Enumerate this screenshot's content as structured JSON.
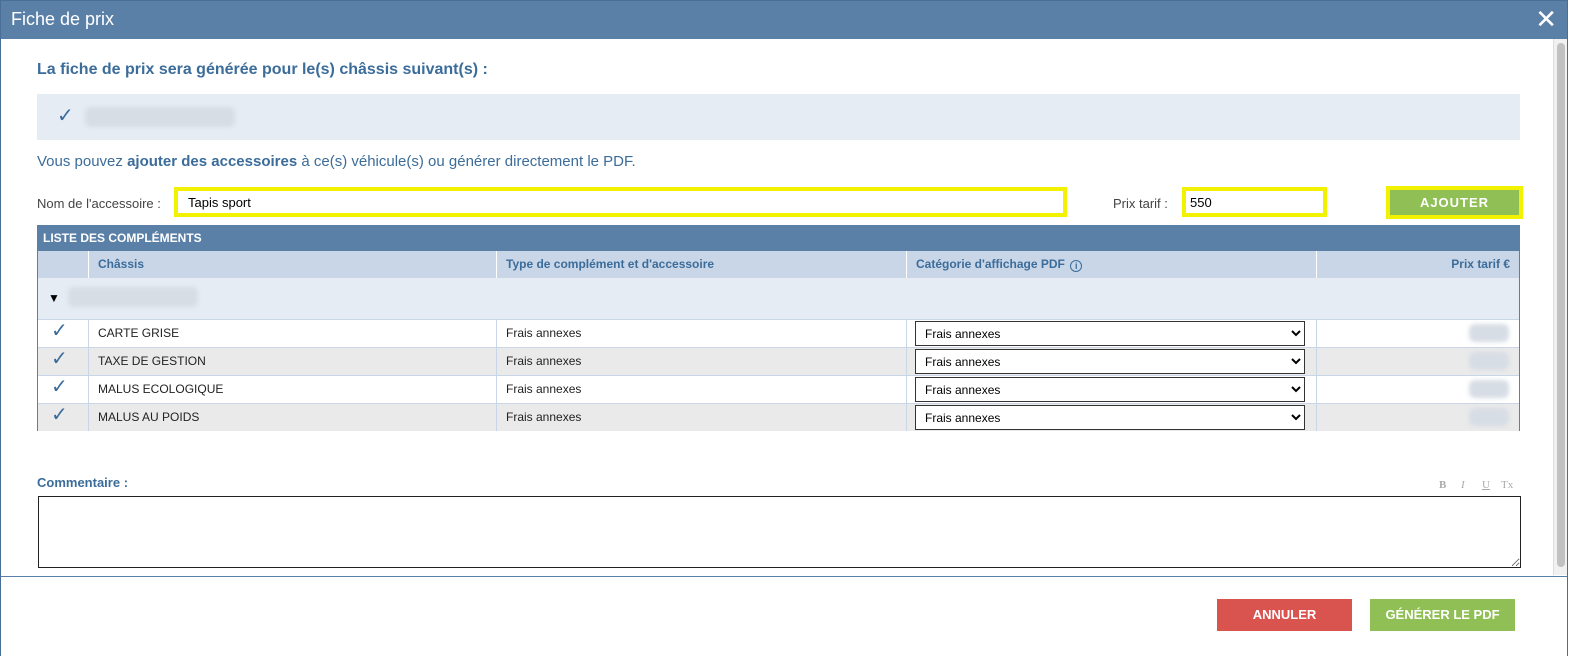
{
  "window": {
    "title": "Fiche de prix",
    "close_glyph": "✕"
  },
  "intro": {
    "heading": "La fiche de prix sera générée pour le(s) châssis suivant(s) :"
  },
  "info": {
    "prefix": "Vous pouvez ",
    "bold": "ajouter des accessoires",
    "suffix": " à ce(s) véhicule(s) ou générer directement le PDF."
  },
  "form": {
    "accessory_label": "Nom de l'accessoire :",
    "accessory_value": "Tapis sport",
    "price_label": "Prix tarif :",
    "price_value": "550",
    "add_button": "AJOUTER"
  },
  "table": {
    "caption": "LISTE DES COMPLÉMENTS",
    "headers": {
      "chassis": "Châssis",
      "type": "Type de complément et d'accessoire",
      "category": "Catégorie d'affichage PDF",
      "price": "Prix tarif €"
    },
    "rows": [
      {
        "chassis": "CARTE GRISE",
        "type": "Frais annexes",
        "category": "Frais annexes"
      },
      {
        "chassis": "TAXE DE GESTION",
        "type": "Frais annexes",
        "category": "Frais annexes"
      },
      {
        "chassis": "MALUS ECOLOGIQUE",
        "type": "Frais annexes",
        "category": "Frais annexes"
      },
      {
        "chassis": "MALUS AU POIDS",
        "type": "Frais annexes",
        "category": "Frais annexes"
      }
    ]
  },
  "comment": {
    "label": "Commentaire :",
    "format_buttons": [
      "B",
      "I",
      "U",
      "Tx"
    ]
  },
  "footer": {
    "cancel": "ANNULER",
    "generate": "GÉNÉRER LE PDF"
  },
  "colors": {
    "header": "#5b80a8",
    "accent_text": "#3b6c9a",
    "green": "#8fbf55",
    "red": "#d9534f",
    "highlight": "#f2f200"
  },
  "icons": {
    "check": "check-icon",
    "close": "close-icon",
    "info": "info-icon",
    "expand": "triangle-down-icon"
  }
}
